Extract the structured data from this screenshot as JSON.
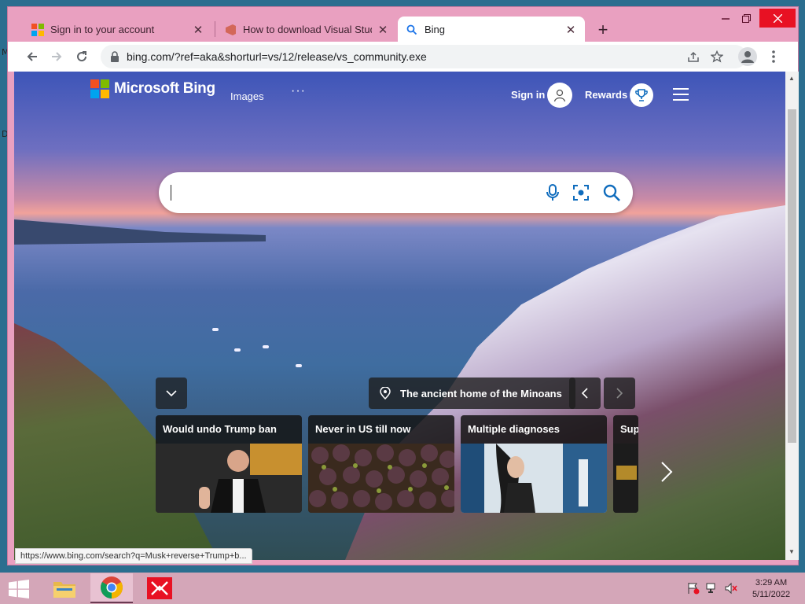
{
  "desktop": {
    "edge_letters": [
      "M",
      "D"
    ]
  },
  "browser": {
    "tabs": [
      {
        "title": "Sign in to your account",
        "icon": "microsoft-logo-icon",
        "active": false
      },
      {
        "title": "How to download Visual Studio C",
        "icon": "visual-studio-icon",
        "active": false
      },
      {
        "title": "Bing",
        "icon": "search-icon",
        "active": true
      }
    ],
    "new_tab_label": "+",
    "address": "bing.com/?ref=aka&shorturl=vs/12/release/vs_community.exe",
    "status_url": "https://www.bing.com/search?q=Musk+reverse+Trump+b..."
  },
  "bing": {
    "brand": "Microsoft Bing",
    "nav": {
      "images": "Images",
      "more": "···"
    },
    "sign_in": "Sign in",
    "rewards": "Rewards",
    "search_placeholder": "",
    "location_caption": "The ancient home of the Minoans",
    "news_cards": [
      {
        "caption": "Would undo Trump ban"
      },
      {
        "caption": "Never in US till now"
      },
      {
        "caption": "Multiple diagnoses"
      },
      {
        "caption": "Sup"
      }
    ]
  },
  "taskbar": {
    "apps": [
      "file-explorer-icon",
      "chrome-icon",
      "visual-studio-installer-icon"
    ],
    "time": "3:29 AM",
    "date": "5/11/2022"
  },
  "colors": {
    "window_frame": "#e9a0c0",
    "bing_blue": "#0f6cbd",
    "close_red": "#e81123"
  }
}
